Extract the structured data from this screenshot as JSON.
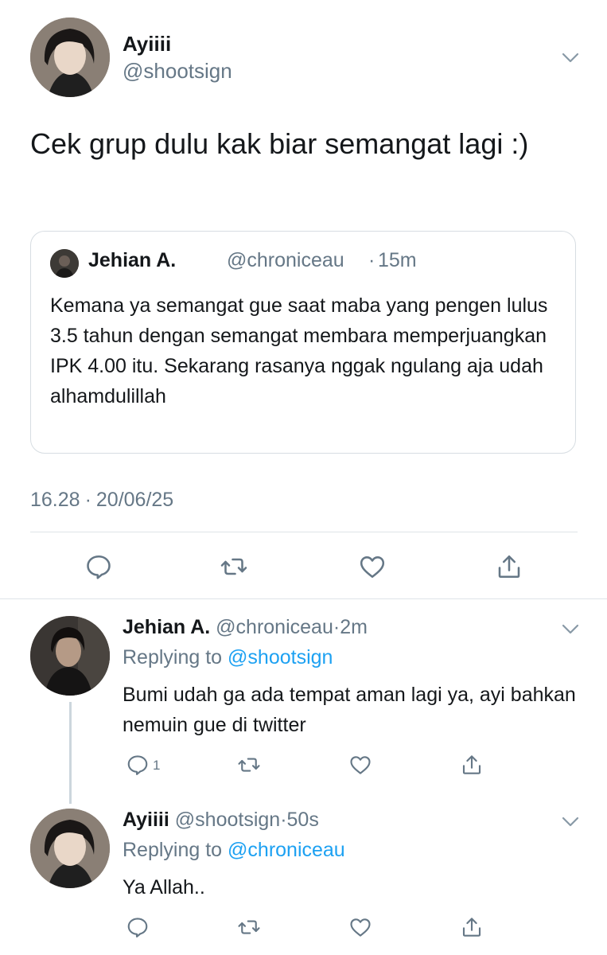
{
  "main_tweet": {
    "name": "Ayiiii",
    "handle": "@shootsign",
    "text": "Cek grup dulu kak biar semangat lagi :)",
    "time": "16.28",
    "date": "20/06/25",
    "separator": "·",
    "quoted": {
      "name": "Jehian A.",
      "handle": "@chroniceau",
      "separator": "·",
      "time": "15m",
      "text": "Kemana ya semangat gue saat maba yang pengen lulus 3.5 tahun dengan semangat membara memperjuangkan IPK 4.00 itu. Sekarang rasanya nggak ngulang aja udah alhamdulillah"
    }
  },
  "replies": [
    {
      "name": "Jehian A.",
      "handle": "@chroniceau",
      "separator": "·",
      "time": "2m",
      "replying_prefix": "Replying to",
      "replying_to": "@shootsign",
      "text": "Bumi udah ga ada tempat aman lagi ya, ayi bahkan nemuin gue di twitter",
      "reply_count": "1"
    },
    {
      "name": "Ayiiii",
      "handle": "@shootsign",
      "separator": "·",
      "time": "50s",
      "replying_prefix": "Replying to",
      "replying_to": "@chroniceau",
      "text": "Ya Allah.."
    }
  ],
  "colors": {
    "accent": "#1da1f2",
    "muted": "#657786",
    "border": "#dfe4e8"
  },
  "icons": [
    "chevron-down-icon",
    "reply-icon",
    "retweet-icon",
    "like-icon",
    "share-icon"
  ]
}
